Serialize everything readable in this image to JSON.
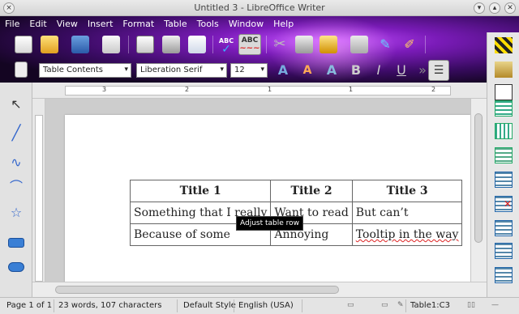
{
  "window": {
    "title": "Untitled 3 - LibreOffice Writer",
    "controls": [
      "chevron-down-icon",
      "chevron-up-icon",
      "close-icon"
    ]
  },
  "menu": [
    {
      "label": "File",
      "key": "F"
    },
    {
      "label": "Edit",
      "key": "E"
    },
    {
      "label": "View",
      "key": "V"
    },
    {
      "label": "Insert",
      "key": "I"
    },
    {
      "label": "Format",
      "key": "o"
    },
    {
      "label": "Table",
      "key": "a"
    },
    {
      "label": "Tools",
      "key": "T"
    },
    {
      "label": "Window",
      "key": "W"
    },
    {
      "label": "Help",
      "key": "H"
    }
  ],
  "toolbar": {
    "paragraph_style": "Table Contents",
    "font_name": "Liberation Serif",
    "font_size": "12",
    "spellcheck_label": "ABC",
    "autospell_label": "ABC"
  },
  "ruler": {
    "numbers": [
      "3",
      "2",
      "1",
      "1",
      "2"
    ]
  },
  "document": {
    "table": {
      "headers": [
        "Title 1",
        "Title 2",
        "Title 3"
      ],
      "rows": [
        [
          "Something that I really",
          "Want to read",
          "But can’t"
        ],
        [
          "Because of some",
          "Annoying",
          "Tooltip in the way"
        ]
      ]
    },
    "tooltip": "Adjust table row"
  },
  "statusbar": {
    "page": "Page 1 of 1",
    "words": "23 words, 107 characters",
    "style": "Default Style",
    "language": "English (USA)",
    "cell": "Table1:C3"
  },
  "colors": {
    "theme_dark": "#140522",
    "theme_purple": "#7a1bb8",
    "theme_glow": "#c24dff"
  }
}
